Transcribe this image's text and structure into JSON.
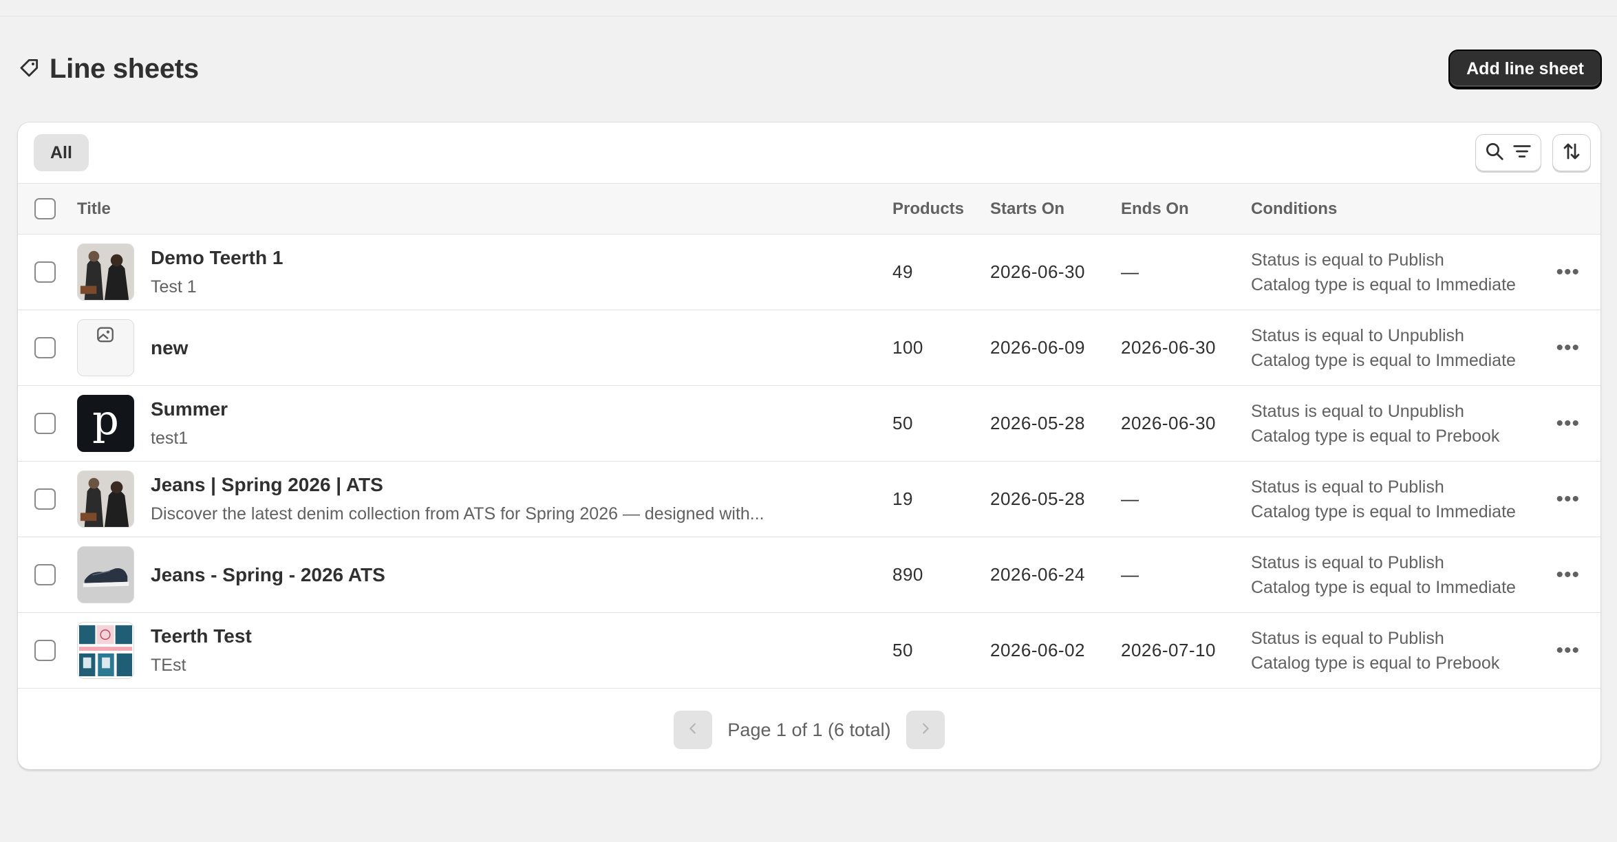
{
  "header": {
    "title": "Line sheets",
    "add_button": "Add line sheet"
  },
  "toolbar": {
    "tab_all": "All"
  },
  "table": {
    "columns": {
      "title": "Title",
      "products": "Products",
      "starts_on": "Starts On",
      "ends_on": "Ends On",
      "conditions": "Conditions"
    },
    "rows": [
      {
        "name": "Demo Teerth 1",
        "subtitle": "Test 1",
        "products": "49",
        "starts": "2026-06-30",
        "ends": "—",
        "cond1": "Status is equal to Publish",
        "cond2": "Catalog type is equal to Immediate",
        "more": "•••"
      },
      {
        "name": "new",
        "subtitle": "",
        "products": "100",
        "starts": "2026-06-09",
        "ends": "2026-06-30",
        "cond1": "Status is equal to Unpublish",
        "cond2": "Catalog type is equal to Immediate",
        "more": "•••"
      },
      {
        "name": "Summer",
        "subtitle": "test1",
        "products": "50",
        "starts": "2026-05-28",
        "ends": "2026-06-30",
        "cond1": "Status is equal to Unpublish",
        "cond2": "Catalog type is equal to Prebook",
        "more": "•••"
      },
      {
        "name": "Jeans | Spring 2026 | ATS",
        "subtitle": "Discover the latest denim collection from ATS for Spring 2026 — designed with...",
        "products": "19",
        "starts": "2026-05-28",
        "ends": "—",
        "cond1": "Status is equal to Publish",
        "cond2": "Catalog type is equal to Immediate",
        "more": "•••"
      },
      {
        "name": "Jeans - Spring - 2026 ATS",
        "subtitle": "",
        "products": "890",
        "starts": "2026-06-24",
        "ends": "—",
        "cond1": "Status is equal to Publish",
        "cond2": "Catalog type is equal to Immediate",
        "more": "•••"
      },
      {
        "name": "Teerth Test",
        "subtitle": "TEst",
        "products": "50",
        "starts": "2026-06-02",
        "ends": "2026-07-10",
        "cond1": "Status is equal to Publish",
        "cond2": "Catalog type is equal to Prebook",
        "more": "•••"
      }
    ]
  },
  "pager": {
    "text": "Page 1 of 1 (6 total)"
  },
  "thumb_letter": "p",
  "colors": {
    "primary": "#303030",
    "background": "#f1f1f1",
    "muted_text": "#616161"
  }
}
